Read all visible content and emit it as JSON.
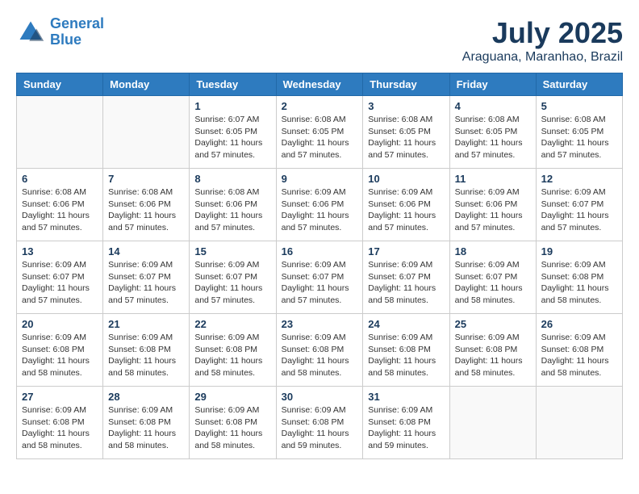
{
  "header": {
    "logo_line1": "General",
    "logo_line2": "Blue",
    "month_title": "July 2025",
    "subtitle": "Araguana, Maranhao, Brazil"
  },
  "days_of_week": [
    "Sunday",
    "Monday",
    "Tuesday",
    "Wednesday",
    "Thursday",
    "Friday",
    "Saturday"
  ],
  "weeks": [
    [
      {
        "day": "",
        "empty": true
      },
      {
        "day": "",
        "empty": true
      },
      {
        "day": "1",
        "sunrise": "6:07 AM",
        "sunset": "6:05 PM",
        "daylight": "11 hours and 57 minutes."
      },
      {
        "day": "2",
        "sunrise": "6:08 AM",
        "sunset": "6:05 PM",
        "daylight": "11 hours and 57 minutes."
      },
      {
        "day": "3",
        "sunrise": "6:08 AM",
        "sunset": "6:05 PM",
        "daylight": "11 hours and 57 minutes."
      },
      {
        "day": "4",
        "sunrise": "6:08 AM",
        "sunset": "6:05 PM",
        "daylight": "11 hours and 57 minutes."
      },
      {
        "day": "5",
        "sunrise": "6:08 AM",
        "sunset": "6:05 PM",
        "daylight": "11 hours and 57 minutes."
      }
    ],
    [
      {
        "day": "6",
        "sunrise": "6:08 AM",
        "sunset": "6:06 PM",
        "daylight": "11 hours and 57 minutes."
      },
      {
        "day": "7",
        "sunrise": "6:08 AM",
        "sunset": "6:06 PM",
        "daylight": "11 hours and 57 minutes."
      },
      {
        "day": "8",
        "sunrise": "6:08 AM",
        "sunset": "6:06 PM",
        "daylight": "11 hours and 57 minutes."
      },
      {
        "day": "9",
        "sunrise": "6:09 AM",
        "sunset": "6:06 PM",
        "daylight": "11 hours and 57 minutes."
      },
      {
        "day": "10",
        "sunrise": "6:09 AM",
        "sunset": "6:06 PM",
        "daylight": "11 hours and 57 minutes."
      },
      {
        "day": "11",
        "sunrise": "6:09 AM",
        "sunset": "6:06 PM",
        "daylight": "11 hours and 57 minutes."
      },
      {
        "day": "12",
        "sunrise": "6:09 AM",
        "sunset": "6:07 PM",
        "daylight": "11 hours and 57 minutes."
      }
    ],
    [
      {
        "day": "13",
        "sunrise": "6:09 AM",
        "sunset": "6:07 PM",
        "daylight": "11 hours and 57 minutes."
      },
      {
        "day": "14",
        "sunrise": "6:09 AM",
        "sunset": "6:07 PM",
        "daylight": "11 hours and 57 minutes."
      },
      {
        "day": "15",
        "sunrise": "6:09 AM",
        "sunset": "6:07 PM",
        "daylight": "11 hours and 57 minutes."
      },
      {
        "day": "16",
        "sunrise": "6:09 AM",
        "sunset": "6:07 PM",
        "daylight": "11 hours and 57 minutes."
      },
      {
        "day": "17",
        "sunrise": "6:09 AM",
        "sunset": "6:07 PM",
        "daylight": "11 hours and 58 minutes."
      },
      {
        "day": "18",
        "sunrise": "6:09 AM",
        "sunset": "6:07 PM",
        "daylight": "11 hours and 58 minutes."
      },
      {
        "day": "19",
        "sunrise": "6:09 AM",
        "sunset": "6:08 PM",
        "daylight": "11 hours and 58 minutes."
      }
    ],
    [
      {
        "day": "20",
        "sunrise": "6:09 AM",
        "sunset": "6:08 PM",
        "daylight": "11 hours and 58 minutes."
      },
      {
        "day": "21",
        "sunrise": "6:09 AM",
        "sunset": "6:08 PM",
        "daylight": "11 hours and 58 minutes."
      },
      {
        "day": "22",
        "sunrise": "6:09 AM",
        "sunset": "6:08 PM",
        "daylight": "11 hours and 58 minutes."
      },
      {
        "day": "23",
        "sunrise": "6:09 AM",
        "sunset": "6:08 PM",
        "daylight": "11 hours and 58 minutes."
      },
      {
        "day": "24",
        "sunrise": "6:09 AM",
        "sunset": "6:08 PM",
        "daylight": "11 hours and 58 minutes."
      },
      {
        "day": "25",
        "sunrise": "6:09 AM",
        "sunset": "6:08 PM",
        "daylight": "11 hours and 58 minutes."
      },
      {
        "day": "26",
        "sunrise": "6:09 AM",
        "sunset": "6:08 PM",
        "daylight": "11 hours and 58 minutes."
      }
    ],
    [
      {
        "day": "27",
        "sunrise": "6:09 AM",
        "sunset": "6:08 PM",
        "daylight": "11 hours and 58 minutes."
      },
      {
        "day": "28",
        "sunrise": "6:09 AM",
        "sunset": "6:08 PM",
        "daylight": "11 hours and 58 minutes."
      },
      {
        "day": "29",
        "sunrise": "6:09 AM",
        "sunset": "6:08 PM",
        "daylight": "11 hours and 58 minutes."
      },
      {
        "day": "30",
        "sunrise": "6:09 AM",
        "sunset": "6:08 PM",
        "daylight": "11 hours and 59 minutes."
      },
      {
        "day": "31",
        "sunrise": "6:09 AM",
        "sunset": "6:08 PM",
        "daylight": "11 hours and 59 minutes."
      },
      {
        "day": "",
        "empty": true
      },
      {
        "day": "",
        "empty": true
      }
    ]
  ]
}
